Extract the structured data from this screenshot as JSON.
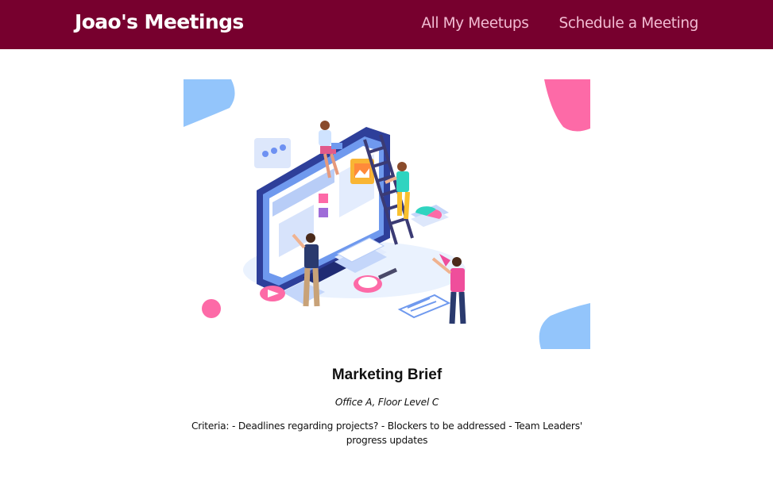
{
  "header": {
    "logo": "Joao's Meetings",
    "nav": [
      {
        "label": "All My Meetups"
      },
      {
        "label": "Schedule a Meeting"
      }
    ],
    "background_color": "#77002e",
    "nav_color": "#f2bcd3"
  },
  "meetup": {
    "image_icon": "team-dashboard-illustration",
    "title": "Marketing Brief",
    "address": "Office A, Floor Level C",
    "description": "Criteria: - Deadlines regarding projects? - Blockers to be addressed - Team Leaders' progress updates"
  }
}
